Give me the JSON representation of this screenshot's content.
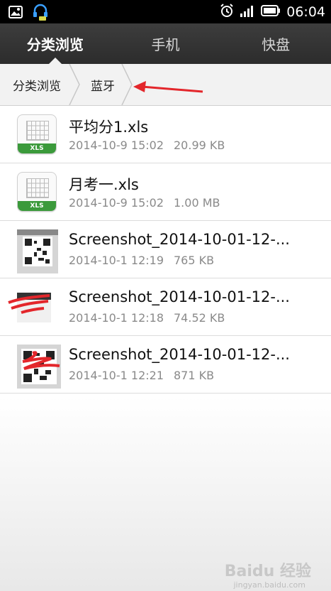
{
  "status_bar": {
    "time": "06:04",
    "left_icons": [
      "image-icon",
      "headset-icon"
    ],
    "right_icons": [
      "alarm-icon",
      "signal-icon",
      "battery-icon"
    ]
  },
  "tabs": [
    {
      "label": "分类浏览",
      "active": true
    },
    {
      "label": "手机",
      "active": false
    },
    {
      "label": "快盘",
      "active": false
    }
  ],
  "breadcrumb": [
    {
      "label": "分类浏览"
    },
    {
      "label": "蓝牙"
    }
  ],
  "files": [
    {
      "name": "平均分1.xls",
      "date": "2014-10-9 15:02",
      "size": "20.99 KB",
      "type": "xls",
      "badge": "XLS"
    },
    {
      "name": "月考一.xls",
      "date": "2014-10-9 15:02",
      "size": "1.00 MB",
      "type": "xls",
      "badge": "XLS"
    },
    {
      "name": "Screenshot_2014-10-01-12-...",
      "date": "2014-10-1 12:19",
      "size": "765 KB",
      "type": "image"
    },
    {
      "name": "Screenshot_2014-10-01-12-...",
      "date": "2014-10-1 12:18",
      "size": "74.52 KB",
      "type": "image"
    },
    {
      "name": "Screenshot_2014-10-01-12-...",
      "date": "2014-10-1 12:21",
      "size": "871 KB",
      "type": "image"
    }
  ],
  "watermark": {
    "text": "Baidu 经验",
    "sub": "jingyan.baidu.com"
  },
  "colors": {
    "accent_green": "#3b9a3b",
    "annotation_red": "#e3262b",
    "tabbar_dark": "#333333"
  }
}
